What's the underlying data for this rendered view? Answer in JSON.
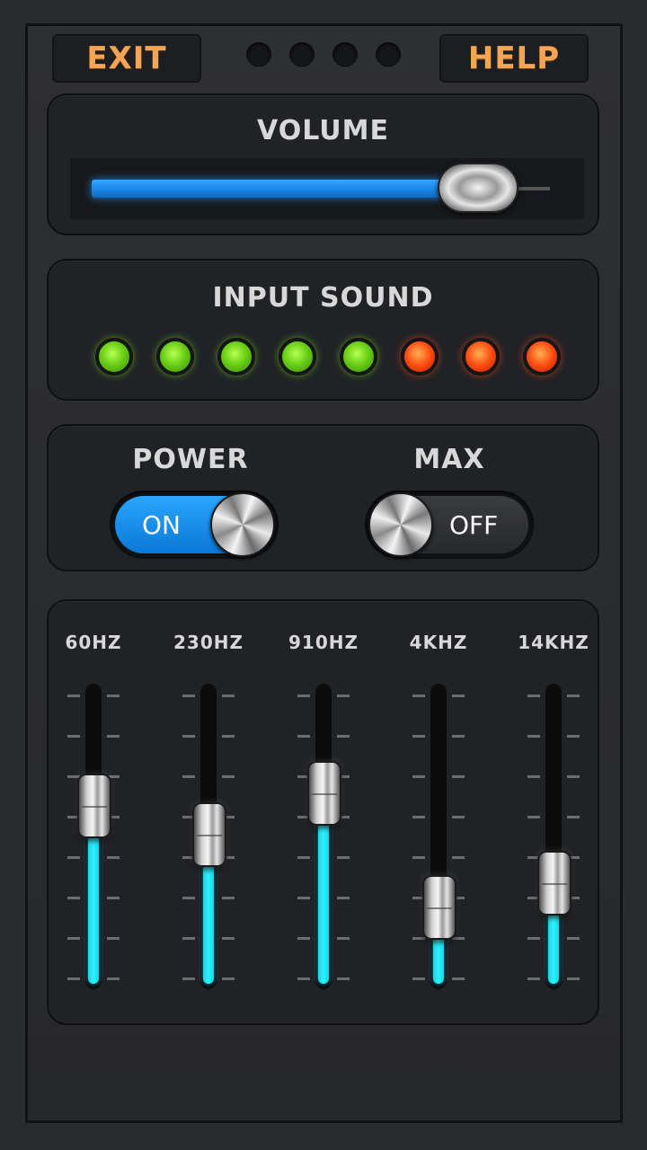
{
  "header": {
    "exit_label": "EXIT",
    "help_label": "HELP"
  },
  "colors": {
    "accent_orange": "#f5a552",
    "volume_blue": "#1684e6",
    "eq_cyan": "#2ff0ff",
    "led_green": "#6ad016",
    "led_red": "#ff4b10"
  },
  "volume": {
    "title": "VOLUME",
    "level": 0.85
  },
  "input_sound": {
    "title": "INPUT SOUND",
    "leds": [
      "green",
      "green",
      "green",
      "green",
      "green",
      "red",
      "red",
      "red"
    ]
  },
  "power": {
    "title": "POWER",
    "state": "ON"
  },
  "max": {
    "title": "MAX",
    "state": "OFF"
  },
  "equalizer": {
    "bands": [
      {
        "label": "60HZ",
        "level": 0.72
      },
      {
        "label": "230HZ",
        "level": 0.6
      },
      {
        "label": "910HZ",
        "level": 0.77
      },
      {
        "label": "4KHZ",
        "level": 0.3
      },
      {
        "label": "14KHZ",
        "level": 0.4
      }
    ]
  }
}
